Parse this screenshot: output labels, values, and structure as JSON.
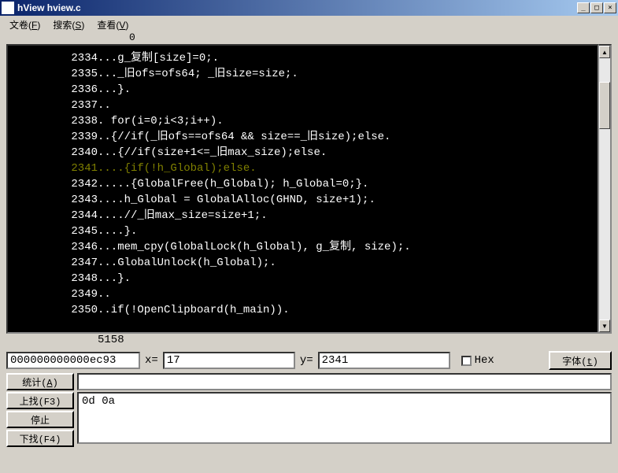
{
  "window": {
    "title": "hView hview.c",
    "icon_glyph": "▦"
  },
  "menus": [
    {
      "label": "文卷",
      "key": "F"
    },
    {
      "label": "搜索",
      "key": "S"
    },
    {
      "label": "查看",
      "key": "V"
    }
  ],
  "ruler": "0",
  "lines": [
    {
      "n": "2334",
      "t": "...g_复制[size]=0;."
    },
    {
      "n": "2335",
      "t": "..._旧ofs=ofs64; _旧size=size;."
    },
    {
      "n": "2336",
      "t": "...}."
    },
    {
      "n": "2337",
      "t": ".."
    },
    {
      "n": "2338",
      "t": ". for(i=0;i<3;i++)."
    },
    {
      "n": "2339",
      "t": "..{//if(_旧ofs==ofs64 && size==_旧size);else."
    },
    {
      "n": "2340",
      "t": "...{//if(size+1<=_旧max_size);else."
    },
    {
      "n": "2341",
      "t": "....{if(!h_Global);else.",
      "hl": true,
      "cursor_after": ")"
    },
    {
      "n": "2342",
      "t": ".....{GlobalFree(h_Global); h_Global=0;}."
    },
    {
      "n": "2343",
      "t": "....h_Global = GlobalAlloc(GHND, size+1);."
    },
    {
      "n": "2344",
      "t": "....//_旧max_size=size+1;."
    },
    {
      "n": "2345",
      "t": "....}."
    },
    {
      "n": "2346",
      "t": "...mem_cpy(GlobalLock(h_Global), g_复制, size);."
    },
    {
      "n": "2347",
      "t": "...GlobalUnlock(h_Global);."
    },
    {
      "n": "2348",
      "t": "...}."
    },
    {
      "n": "2349",
      "t": ".."
    },
    {
      "n": "2350",
      "t": "..if(!OpenClipboard(h_main))."
    }
  ],
  "end_total": "5158",
  "fields": {
    "addr": "000000000000ec93",
    "x_label": "x=",
    "x": "17",
    "y_label": "y=",
    "y": "2341",
    "hex_label": "Hex",
    "font_btn": "字体(t)",
    "font_key": "t",
    "stats_btn": "统计(A)",
    "stats_key": "A",
    "up_btn": "上找(F3)",
    "stop_btn": "停止",
    "down_btn": "下找(F4)",
    "blank": "",
    "search_text": "0d 0a"
  },
  "win_btns": {
    "min": "_",
    "max": "□",
    "close": "×"
  }
}
